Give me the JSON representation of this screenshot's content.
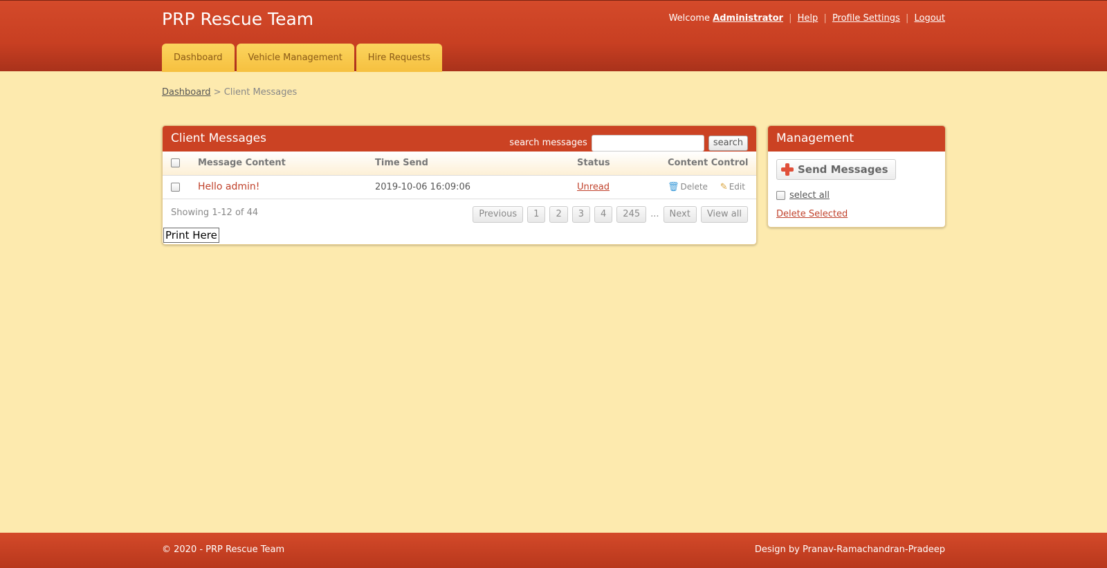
{
  "header": {
    "title": "PRP Rescue Team",
    "welcome": "Welcome",
    "user": "Administrator",
    "help": "Help",
    "profile_settings": "Profile Settings",
    "logout": "Logout",
    "tabs": [
      "Dashboard",
      "Vehicle Management",
      "Hire Requests"
    ]
  },
  "breadcrumb": {
    "root": "Dashboard",
    "separator": ">",
    "current": "Client Messages"
  },
  "messages_panel": {
    "title": "Client Messages",
    "search_label": "search messages",
    "search_value": "",
    "search_button": "search",
    "columns": [
      "Message Content",
      "Time Send",
      "Status",
      "Content Control"
    ],
    "rows": [
      {
        "content": "Hello admin!",
        "time": "2019-10-06 16:09:06",
        "status": "Unread",
        "delete_label": "Delete",
        "edit_label": "Edit"
      }
    ],
    "showing": "Showing 1-12 of 44",
    "pager": {
      "previous": "Previous",
      "pages": [
        "1",
        "2",
        "3",
        "4",
        "245"
      ],
      "ellipsis": "...",
      "next": "Next",
      "view_all": "View all"
    },
    "print_button": "Print Here"
  },
  "management_panel": {
    "title": "Management",
    "send_button": "Send Messages",
    "select_all": "select all",
    "delete_selected": "Delete Selected"
  },
  "footer": {
    "copyright": "© 2020 - PRP Rescue Team",
    "design": "Design by Pranav-Ramachandran-Pradeep"
  },
  "colors": {
    "header_red": "#cb4223",
    "background": "#fdeaae",
    "tab_yellow": "#f6c03f",
    "link_red": "#c0412a"
  }
}
